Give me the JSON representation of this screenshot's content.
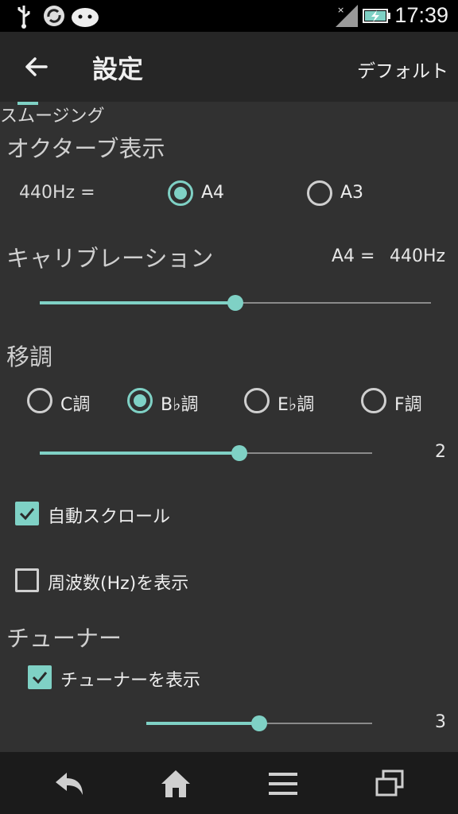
{
  "status_bar": {
    "time": "17:39",
    "icons": [
      "usb-icon",
      "sync-icon",
      "android-icon",
      "signal-icon",
      "battery-charging-icon"
    ]
  },
  "app_bar": {
    "title": "設定",
    "default_label": "デフォルト",
    "back_icon": "arrow-left-icon"
  },
  "octave": {
    "title": "オクターブ表示",
    "prefix": "440Hz =",
    "options": [
      {
        "label": "A4",
        "selected": true
      },
      {
        "label": "A3",
        "selected": false
      }
    ]
  },
  "calibration": {
    "title": "キャリブレーション",
    "note": "A4 =",
    "frequency": "440Hz",
    "slider_fraction": 0.5
  },
  "transpose": {
    "title": "移調",
    "options": [
      {
        "label": "C調",
        "selected": false
      },
      {
        "label": "B♭調",
        "selected": true
      },
      {
        "label": "E♭調",
        "selected": false
      },
      {
        "label": "F調",
        "selected": false
      }
    ],
    "slider_value": "2",
    "slider_fraction": 0.6
  },
  "auto_scroll": {
    "label": "自動スクロール",
    "checked": true
  },
  "show_freq": {
    "label": "周波数(Hz)を表示",
    "checked": false
  },
  "tuner": {
    "title": "チューナー",
    "show_tuner": {
      "label": "チューナーを表示",
      "checked": true
    },
    "smoothing_label": "スムージング",
    "smoothing_value": "3",
    "slider_fraction": 0.5
  },
  "colors": {
    "accent": "#7fd1c5",
    "background": "#313131",
    "appbar": "#262626"
  },
  "nav_bar": {
    "icons": [
      "back-icon",
      "home-icon",
      "menu-icon",
      "recent-apps-icon"
    ]
  }
}
